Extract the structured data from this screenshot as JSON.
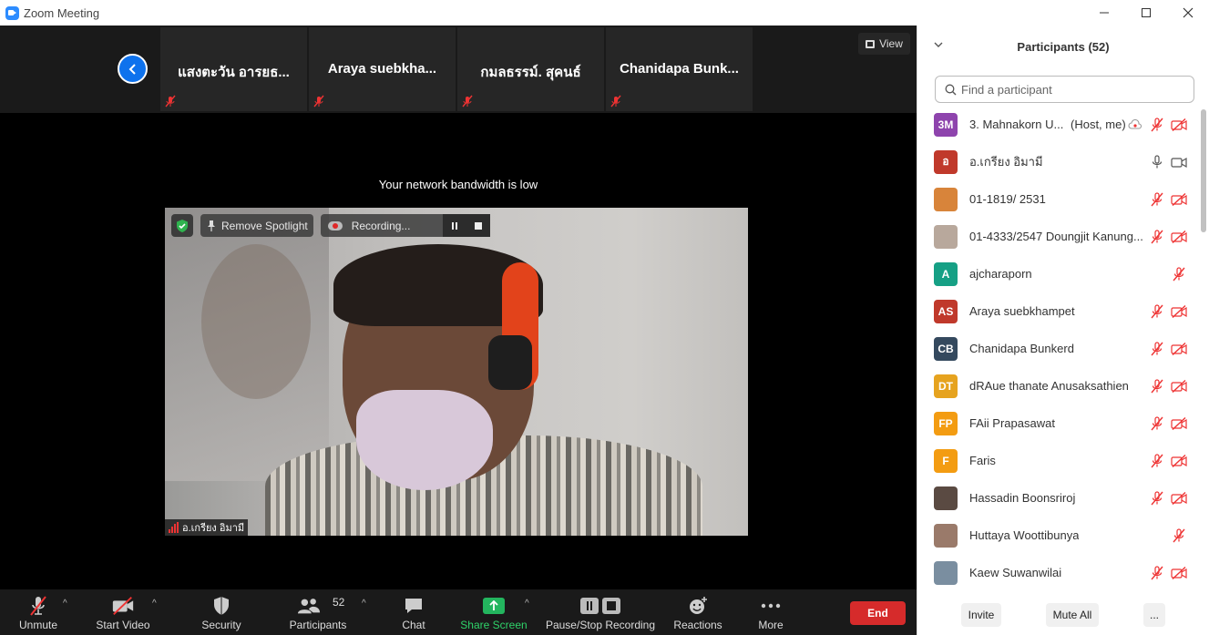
{
  "window": {
    "title": "Zoom Meeting"
  },
  "strip": {
    "thumbs": [
      {
        "name": "แสงตะวัน อารยธ..."
      },
      {
        "name": "Araya  suebkha..."
      },
      {
        "name": "กมลธรรม์. สุคนธ์"
      },
      {
        "name": "Chanidapa  Bunk..."
      }
    ],
    "view_label": "View"
  },
  "notice": "Your network bandwidth is low",
  "video": {
    "remove_spotlight_label": "Remove Spotlight",
    "recording_label": "Recording...",
    "speaker_name": "อ.เกรียง อิมามี"
  },
  "toolbar": {
    "unmute": "Unmute",
    "start_video": "Start Video",
    "security": "Security",
    "participants": "Participants",
    "participants_count": "52",
    "chat": "Chat",
    "share_screen": "Share Screen",
    "pause_stop": "Pause/Stop Recording",
    "reactions": "Reactions",
    "more": "More",
    "end": "End"
  },
  "panel": {
    "title": "Participants (52)",
    "search_placeholder": "Find a participant",
    "participants": [
      {
        "initials": "3M",
        "color": "#8e44ad",
        "name": "3. Mahnakorn U...",
        "tag": "(Host, me)"
      },
      {
        "initials": "อ",
        "color": "#c0392b",
        "name": "อ.เกรียง อิมามี"
      },
      {
        "initials": "",
        "color": "#d8843a",
        "name": "01-1819/ 2531"
      },
      {
        "initials": "",
        "color": "#b8a89c",
        "name": "01-4333/2547 Doungjit Kanung..."
      },
      {
        "initials": "A",
        "color": "#16a085",
        "name": "ajcharaporn"
      },
      {
        "initials": "AS",
        "color": "#c0392b",
        "name": "Araya suebkhampet"
      },
      {
        "initials": "CB",
        "color": "#34495e",
        "name": "Chanidapa Bunkerd"
      },
      {
        "initials": "DT",
        "color": "#e6a31f",
        "name": "dRAue thanate Anusaksathien"
      },
      {
        "initials": "FP",
        "color": "#f39c12",
        "name": "FAii Prapasawat"
      },
      {
        "initials": "F",
        "color": "#f39c12",
        "name": "Faris"
      },
      {
        "initials": "",
        "color": "#5a4a42",
        "name": "Hassadin Boonsriroj"
      },
      {
        "initials": "",
        "color": "#9a7a6a",
        "name": "Huttaya Woottibunya"
      },
      {
        "initials": "",
        "color": "#7a8ea0",
        "name": "Kaew Suwanwilai"
      }
    ],
    "invite": "Invite",
    "mute_all": "Mute All",
    "more": "..."
  }
}
